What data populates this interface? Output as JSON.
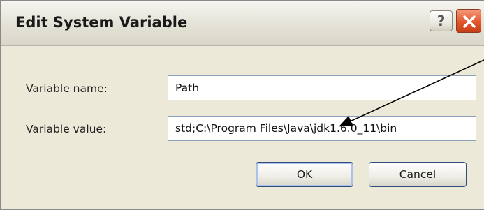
{
  "window": {
    "title": "Edit System Variable",
    "help_icon": "help-icon",
    "help_glyph": "?",
    "close_icon": "close-icon"
  },
  "form": {
    "name_label": "Variable name:",
    "name_value": "Path",
    "value_label": "Variable value:",
    "value_value": "std;C:\\Program Files\\Java\\jdk1.6.0_11\\bin"
  },
  "buttons": {
    "ok_label": "OK",
    "cancel_label": "Cancel"
  },
  "colors": {
    "dialog_background": "#ece9d8",
    "close_button": "#e2562c",
    "default_button_highlight": "#a9c3ec"
  }
}
